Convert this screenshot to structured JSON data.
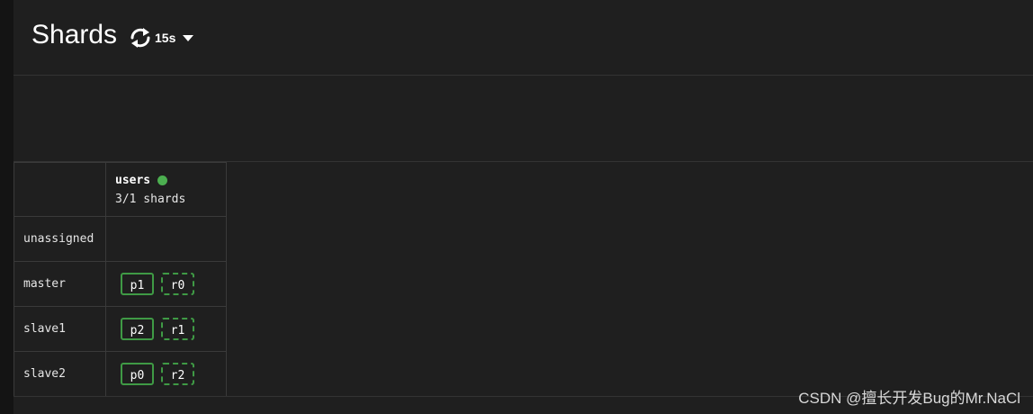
{
  "header": {
    "title": "Shards",
    "refresh_icon": "refresh-icon",
    "refresh_interval": "15s",
    "dropdown_icon": "caret-down-icon"
  },
  "index": {
    "name": "users",
    "status_color": "#4caf50",
    "status": "green",
    "shards_summary": "3/1 shards"
  },
  "rows": [
    {
      "node": "unassigned",
      "shards": []
    },
    {
      "node": "master",
      "shards": [
        {
          "label": "p1",
          "type": "primary"
        },
        {
          "label": "r0",
          "type": "replica"
        }
      ]
    },
    {
      "node": "slave1",
      "shards": [
        {
          "label": "p2",
          "type": "primary"
        },
        {
          "label": "r1",
          "type": "replica"
        }
      ]
    },
    {
      "node": "slave2",
      "shards": [
        {
          "label": "p0",
          "type": "primary"
        },
        {
          "label": "r2",
          "type": "replica"
        }
      ]
    }
  ],
  "watermark": "CSDN @擅长开发Bug的Mr.NaCl",
  "colors": {
    "background": "#1f1f1f",
    "shard_border": "#3f9a45"
  }
}
